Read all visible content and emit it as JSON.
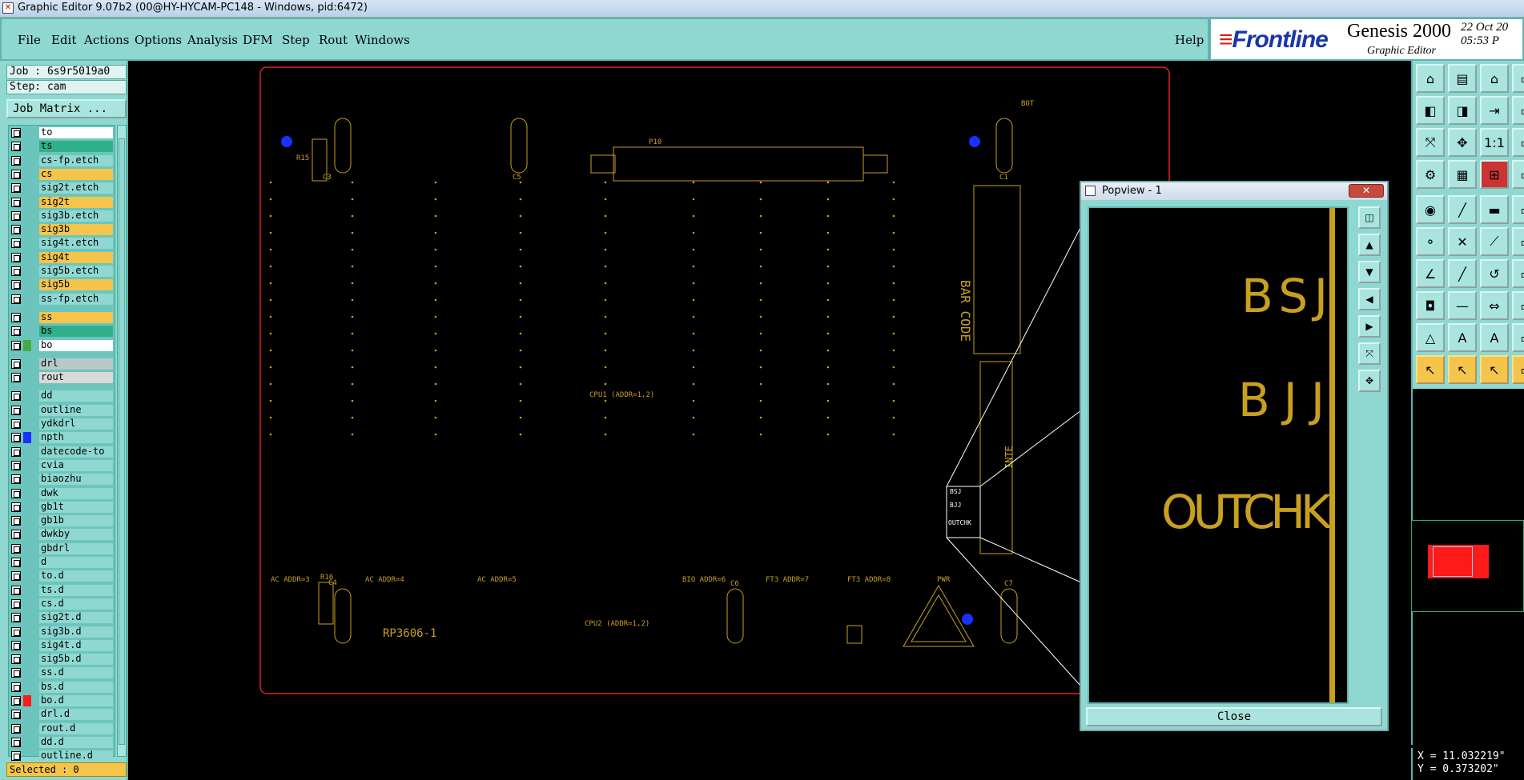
{
  "window": {
    "title": "Graphic Editor 9.07b2 (00@HY-HYCAM-PC148 - Windows, pid:6472)"
  },
  "menu": {
    "items": [
      "File",
      "Edit",
      "Actions",
      "Options",
      "Analysis",
      "DFM",
      "Step",
      "Rout",
      "Windows"
    ],
    "help": "Help"
  },
  "brand": {
    "logo": "Frontline",
    "product": "Genesis 2000",
    "subtitle": "Graphic Editor",
    "date": "22 Oct 20",
    "time": "05:53 P"
  },
  "job": {
    "job_label": "Job : 6s9r5019a0",
    "step_label": "Step: cam",
    "matrix_button": "Job Matrix ..."
  },
  "layers": [
    {
      "name": "to",
      "color": "#ffffff",
      "marker": ""
    },
    {
      "name": "ts",
      "color": "#2fb08a",
      "marker": ""
    },
    {
      "name": "cs-fp.etch",
      "color": "#8fd8d2",
      "marker": ""
    },
    {
      "name": "cs",
      "color": "#f5c44a",
      "marker": ""
    },
    {
      "name": "sig2t.etch",
      "color": "#8fd8d2",
      "marker": ""
    },
    {
      "name": "sig2t",
      "color": "#f5c44a",
      "marker": ""
    },
    {
      "name": "sig3b.etch",
      "color": "#8fd8d2",
      "marker": ""
    },
    {
      "name": "sig3b",
      "color": "#f5c44a",
      "marker": ""
    },
    {
      "name": "sig4t.etch",
      "color": "#8fd8d2",
      "marker": ""
    },
    {
      "name": "sig4t",
      "color": "#f5c44a",
      "marker": ""
    },
    {
      "name": "sig5b.etch",
      "color": "#8fd8d2",
      "marker": ""
    },
    {
      "name": "sig5b",
      "color": "#f5c44a",
      "marker": ""
    },
    {
      "name": "ss-fp.etch",
      "color": "#8fd8d2",
      "marker": ""
    },
    {
      "name": "ss",
      "color": "#f5c44a",
      "marker": ""
    },
    {
      "name": "bs",
      "color": "#2fb08a",
      "marker": ""
    },
    {
      "name": "bo",
      "color": "#ffffff",
      "marker": "#4a4"
    },
    {
      "name": "drl",
      "color": "#b7c9c7",
      "marker": ""
    },
    {
      "name": "rout",
      "color": "#d9d9d9",
      "marker": ""
    },
    {
      "name": "dd",
      "color": "#8fd8d2",
      "marker": ""
    },
    {
      "name": "outline",
      "color": "#8fd8d2",
      "marker": ""
    },
    {
      "name": "ydkdrl",
      "color": "#8fd8d2",
      "marker": ""
    },
    {
      "name": "npth",
      "color": "#8fd8d2",
      "marker": "#1a30ff"
    },
    {
      "name": "datecode-to",
      "color": "#8fd8d2",
      "marker": ""
    },
    {
      "name": "cvia",
      "color": "#8fd8d2",
      "marker": ""
    },
    {
      "name": "biaozhu",
      "color": "#8fd8d2",
      "marker": ""
    },
    {
      "name": "dwk",
      "color": "#8fd8d2",
      "marker": ""
    },
    {
      "name": "gb1t",
      "color": "#8fd8d2",
      "marker": ""
    },
    {
      "name": "gb1b",
      "color": "#8fd8d2",
      "marker": ""
    },
    {
      "name": "dwkby",
      "color": "#8fd8d2",
      "marker": ""
    },
    {
      "name": "gbdrl",
      "color": "#8fd8d2",
      "marker": ""
    },
    {
      "name": "d",
      "color": "#8fd8d2",
      "marker": ""
    },
    {
      "name": "to.d",
      "color": "#8fd8d2",
      "marker": ""
    },
    {
      "name": "ts.d",
      "color": "#8fd8d2",
      "marker": ""
    },
    {
      "name": "cs.d",
      "color": "#8fd8d2",
      "marker": ""
    },
    {
      "name": "sig2t.d",
      "color": "#8fd8d2",
      "marker": ""
    },
    {
      "name": "sig3b.d",
      "color": "#8fd8d2",
      "marker": ""
    },
    {
      "name": "sig4t.d",
      "color": "#8fd8d2",
      "marker": ""
    },
    {
      "name": "sig5b.d",
      "color": "#8fd8d2",
      "marker": ""
    },
    {
      "name": "ss.d",
      "color": "#8fd8d2",
      "marker": ""
    },
    {
      "name": "bs.d",
      "color": "#8fd8d2",
      "marker": ""
    },
    {
      "name": "bo.d",
      "color": "#8fd8d2",
      "marker": "#ff1a1a"
    },
    {
      "name": "drl.d",
      "color": "#8fd8d2",
      "marker": ""
    },
    {
      "name": "rout.d",
      "color": "#8fd8d2",
      "marker": ""
    },
    {
      "name": "dd.d",
      "color": "#8fd8d2",
      "marker": ""
    },
    {
      "name": "outline.d",
      "color": "#8fd8d2",
      "marker": ""
    }
  ],
  "selected_label": "Selected : 0",
  "popview": {
    "title": "Popview - 1",
    "close_x": "✕",
    "close_button": "Close",
    "texts": [
      "BSJ",
      "BJJ",
      "OUTCHK"
    ]
  },
  "board": {
    "labels": {
      "bot": "BOT",
      "p10": "P10",
      "barcode": "BAR CODE",
      "inte": "INTE",
      "part": "RP3606-1",
      "cpu1": "CPU1 (ADDR=1,2)",
      "cpu2": "CPU2 (ADDR=1,2)",
      "r15": "R15",
      "r16": "R16",
      "c3": "C3",
      "c4": "C4",
      "c5": "C5",
      "c1": "C1",
      "c6": "C6",
      "c7": "C7",
      "bsj": "BSJ",
      "bjj": "BJJ",
      "outchk": "OUTCHK",
      "acaddr3": "AC ADDR=3",
      "acaddr4": "AC ADDR=4",
      "acaddr5": "AC ADDR=5",
      "bioaddr6": "BIO ADDR=6",
      "ft3addr7": "FT3 ADDR=7",
      "ft3addr8": "FT3 ADDR=8",
      "pwr": "PWR"
    }
  },
  "coords": {
    "x": "X = 11.032219\"",
    "y": "Y = 0.373202\""
  },
  "colors": {
    "panel": "#8fd8d2",
    "silk": "#c8a020",
    "board_outline": "#e02020",
    "hole": "#1a30ff"
  }
}
